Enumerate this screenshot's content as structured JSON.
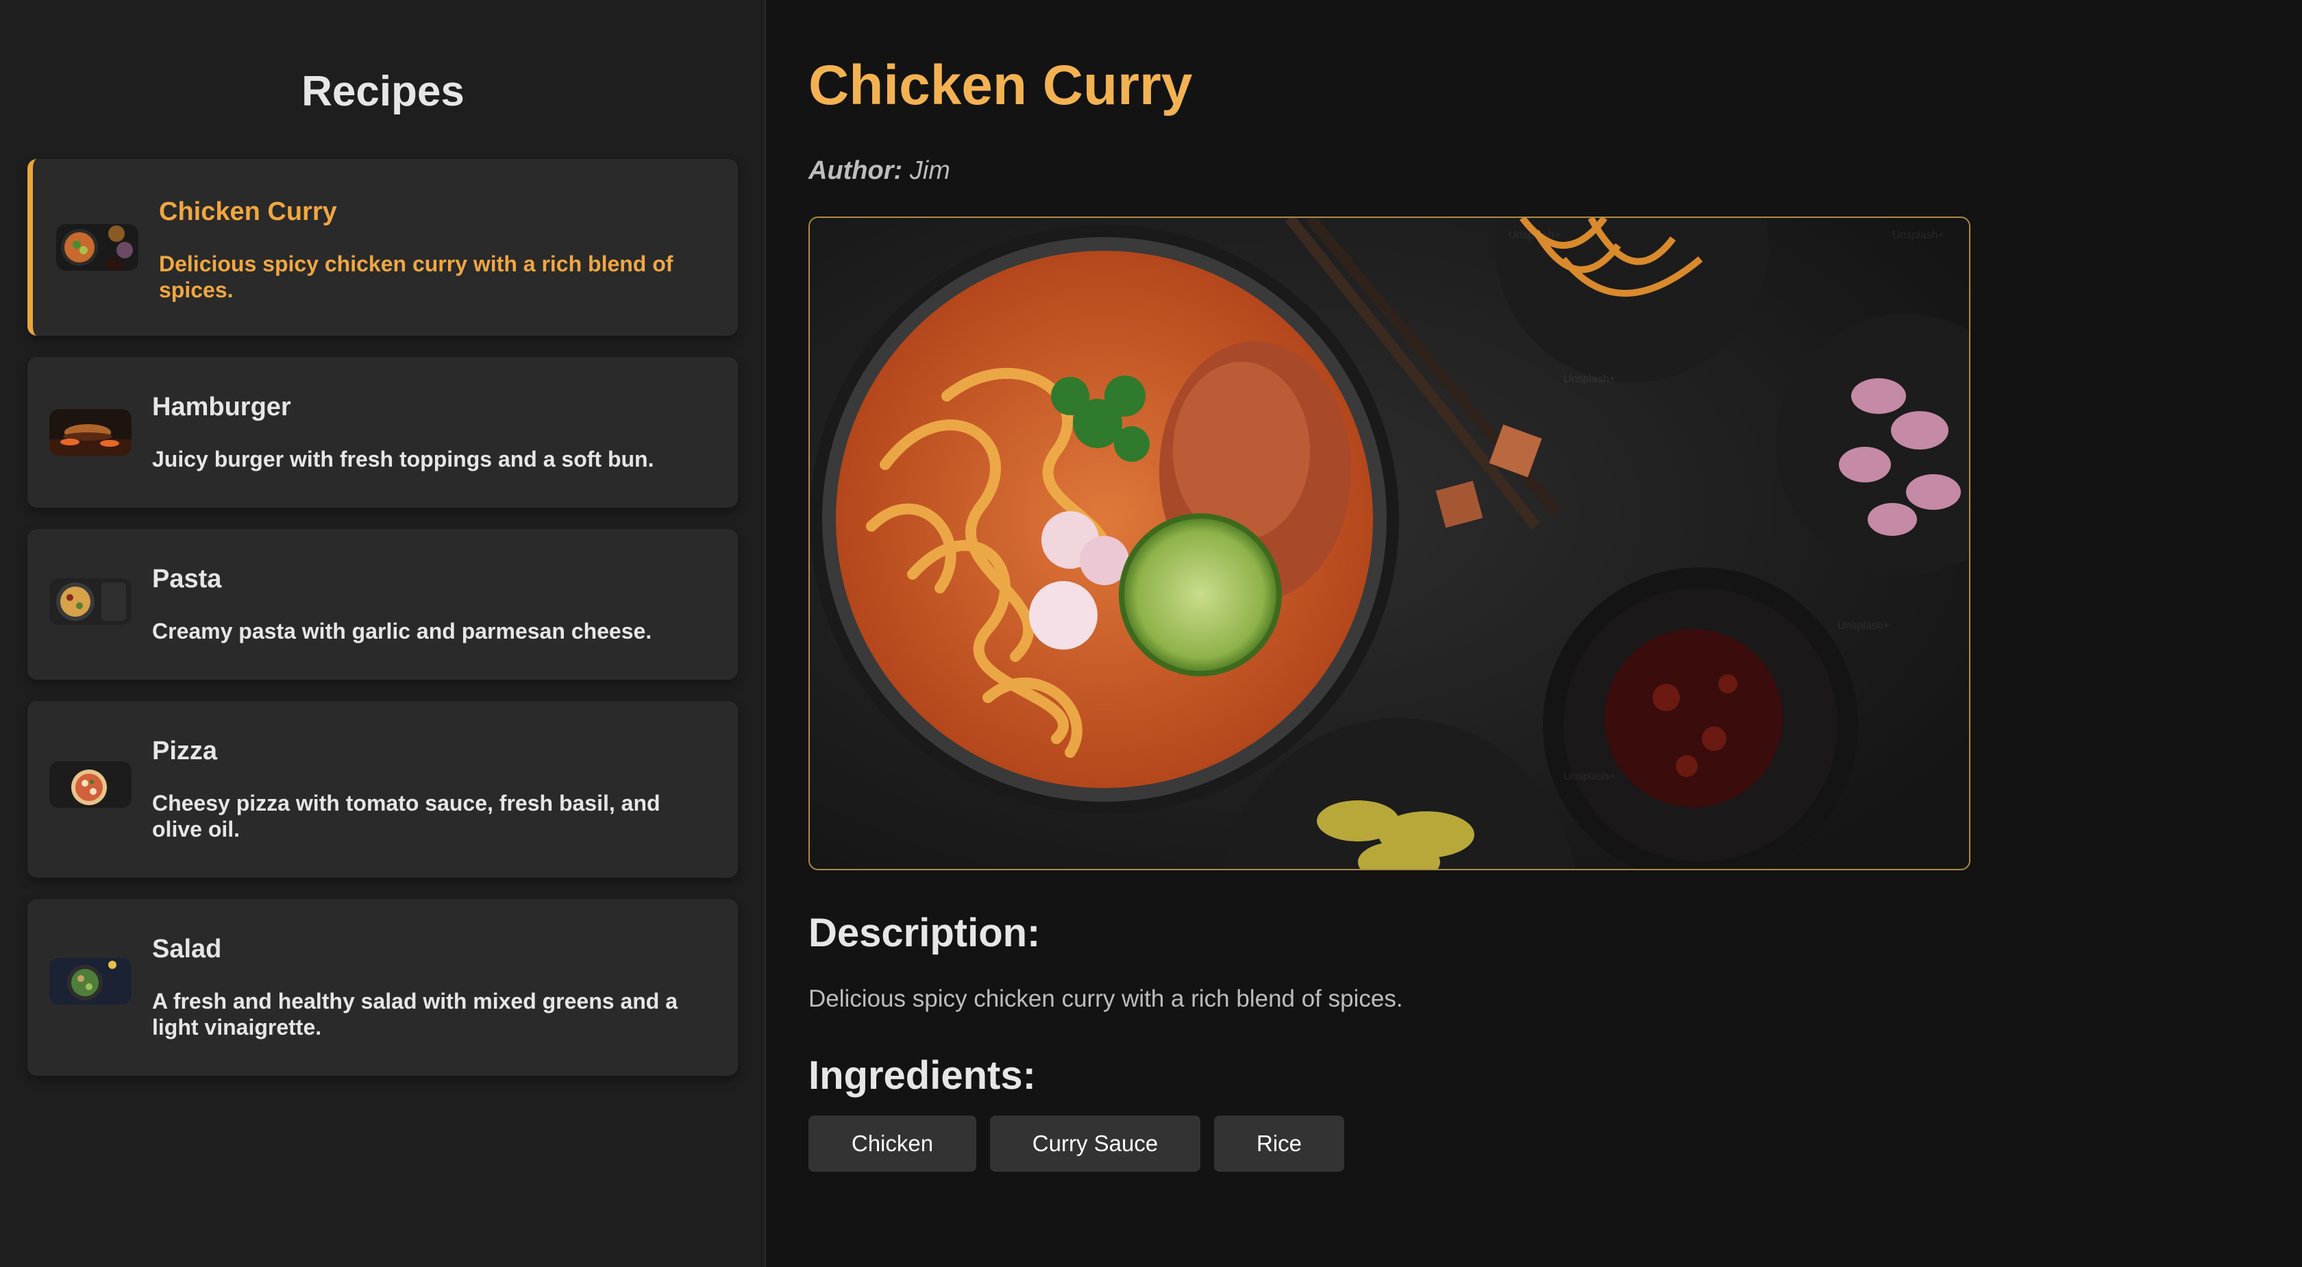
{
  "sidebar": {
    "title": "Recipes",
    "items": [
      {
        "name": "Chicken Curry",
        "description": "Delicious spicy chicken curry with a rich blend of spices.",
        "active": true
      },
      {
        "name": "Hamburger",
        "description": "Juicy burger with fresh toppings and a soft bun.",
        "active": false
      },
      {
        "name": "Pasta",
        "description": "Creamy pasta with garlic and parmesan cheese.",
        "active": false
      },
      {
        "name": "Pizza",
        "description": "Cheesy pizza with tomato sauce, fresh basil, and olive oil.",
        "active": false
      },
      {
        "name": "Salad",
        "description": "A fresh and healthy salad with mixed greens and a light vinaigrette.",
        "active": false
      }
    ]
  },
  "recipe": {
    "title": "Chicken Curry",
    "author_label": "Author:",
    "author": "Jim",
    "image_watermark": "Unsplash+",
    "description_heading": "Description:",
    "description": "Delicious spicy chicken curry with a rich blend of spices.",
    "ingredients_heading": "Ingredients:",
    "ingredients": [
      "Chicken",
      "Curry Sauce",
      "Rice"
    ]
  },
  "colors": {
    "accent": "#f3b252",
    "active_text": "#f0a741",
    "background": "#131313",
    "sidebar": "#1e1e1e",
    "card": "#2a2a2a"
  }
}
